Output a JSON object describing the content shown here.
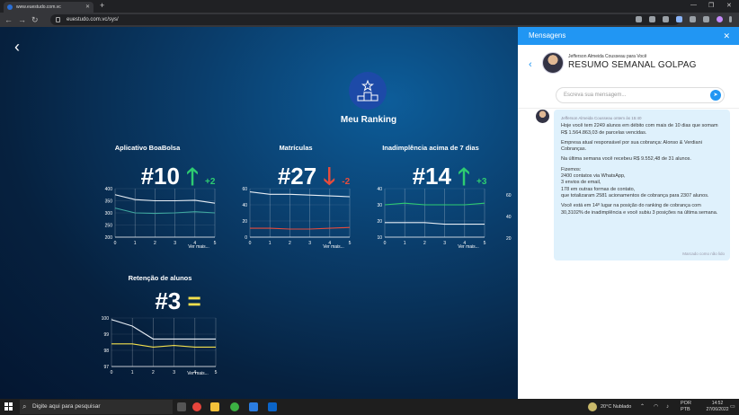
{
  "browser": {
    "tab_title": "www.euestudo.com.vc",
    "url": "euestudo.com.vc/sys/"
  },
  "main": {
    "ranking_title": "Meu Ranking",
    "see_more": "Ver mais...",
    "cards": [
      {
        "title": "Aplicativo BoaBolsa",
        "rank": "#10",
        "trend": "up",
        "delta": "+2",
        "chart_data": {
          "type": "line",
          "x": [
            0,
            1,
            2,
            3,
            4,
            5
          ],
          "ylim": [
            200,
            400
          ],
          "yticks": [
            200,
            250,
            300,
            350,
            400
          ],
          "series": [
            {
              "color": "#e8eef5",
              "values": [
                375,
                355,
                350,
                350,
                352,
                340
              ]
            },
            {
              "color": "#3fa8a0",
              "values": [
                320,
                300,
                298,
                300,
                305,
                300
              ]
            }
          ]
        }
      },
      {
        "title": "Matrículas",
        "rank": "#27",
        "trend": "down",
        "delta": "-2",
        "chart_data": {
          "type": "line",
          "x": [
            0,
            1,
            2,
            3,
            4,
            5
          ],
          "ylim": [
            0,
            60
          ],
          "yticks": [
            0,
            20,
            40,
            60
          ],
          "series": [
            {
              "color": "#e8eef5",
              "values": [
                56,
                53,
                53,
                52,
                51,
                50
              ]
            },
            {
              "color": "#e74c3c",
              "values": [
                11,
                11,
                10,
                10,
                11,
                12
              ]
            }
          ]
        }
      },
      {
        "title": "Inadimplência acima de 7 dias",
        "rank": "#14",
        "trend": "up",
        "delta": "+3",
        "chart_data": {
          "type": "line",
          "x": [
            0,
            1,
            2,
            3,
            4,
            5
          ],
          "ylim": [
            10,
            40
          ],
          "yticks": [
            10,
            20,
            30,
            40
          ],
          "series": [
            {
              "color": "#2ecc71",
              "values": [
                30,
                31,
                30,
                30,
                30,
                31
              ]
            },
            {
              "color": "#e8eef5",
              "values": [
                19,
                19,
                19,
                18,
                18,
                18
              ]
            }
          ]
        }
      },
      {
        "title": "Retenção de alunos",
        "rank": "#3",
        "trend": "equal",
        "delta": "",
        "chart_data": {
          "type": "line",
          "x": [
            0,
            1,
            2,
            3,
            4,
            5
          ],
          "ylim": [
            97,
            100
          ],
          "yticks": [
            97,
            98,
            99,
            100
          ],
          "series": [
            {
              "color": "#e8eef5",
              "values": [
                99.9,
                99.5,
                98.7,
                98.7,
                98.7,
                98.7
              ]
            },
            {
              "color": "#f4e04d",
              "values": [
                98.4,
                98.4,
                98.2,
                98.3,
                98.2,
                98.2
              ]
            }
          ]
        }
      }
    ],
    "partial_card_yticks": [
      "60",
      "40",
      "20"
    ]
  },
  "panel": {
    "header": "Mensagens",
    "close": "✕",
    "from": "Jefferson Almeida Cousseau para Você",
    "subject": "RESUMO SEMANAL GOLPAG",
    "input_placeholder": "Escreva sua mensagem...",
    "message": {
      "meta": "Jefferson Almeida Cousseau ontem às 15:40",
      "p1": "Hoje você tem 2249 alunos em débito com mais de 10 dias que somam R$ 1.564.863,03 de parcelas vencidas.",
      "p2": "Empresa atual responsável por sua cobrança: Alonso & Verdiani Cobranças.",
      "p3": "Na última semana você recebeu R$ 9.552,48 de 31 alunos.",
      "p4a": "Fizemos:",
      "p4b": "2400 contatos via WhatsApp,",
      "p4c": "3 envios de email,",
      "p4d": "178 em outras formas de contato,",
      "p4e": "que totalizaram 2581 acionamentos de cobrança para 2307 alunos.",
      "p5": "Você está em 14º lugar na posição do ranking de cobrança com 30,3102% de inadimplência e você subiu 3 posições na última semana.",
      "ts": "Marcado como não lido"
    }
  },
  "taskbar": {
    "search_placeholder": "Digite aqui para pesquisar",
    "weather": "20°C  Nublado",
    "lang": "POR\nPTB",
    "time": "14:52",
    "date": "27/06/2022"
  }
}
